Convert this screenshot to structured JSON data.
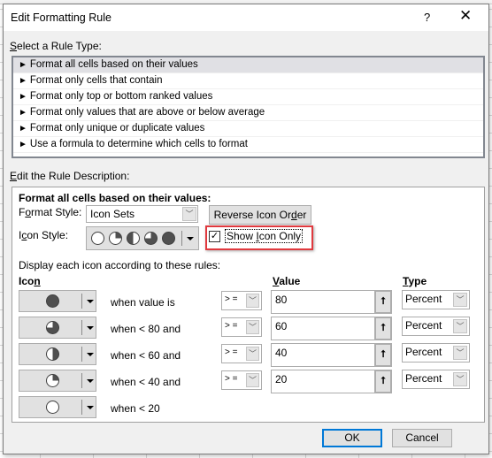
{
  "dialog": {
    "title": "Edit Formatting Rule",
    "help_label": "?",
    "close_label": "✕"
  },
  "rule_type": {
    "label_accel": "S",
    "label_rest": "elect a Rule Type:",
    "arrow_glyph": "►",
    "items": [
      {
        "label": "Format all cells based on their values",
        "selected": true
      },
      {
        "label": "Format only cells that contain",
        "selected": false
      },
      {
        "label": "Format only top or bottom ranked values",
        "selected": false
      },
      {
        "label": "Format only values that are above or below average",
        "selected": false
      },
      {
        "label": "Format only unique or duplicate values",
        "selected": false
      },
      {
        "label": "Use a formula to determine which cells to format",
        "selected": false
      }
    ]
  },
  "rule_description": {
    "label_accel": "E",
    "label_rest": "dit the Rule Description:",
    "heading": "Format all cells based on their values:",
    "format_style_pre": "F",
    "format_style_accel": "o",
    "format_style_post": "rmat Style:",
    "format_style_value": "Icon Sets",
    "reverse_pre": "Reverse Icon Or",
    "reverse_accel": "d",
    "reverse_post": "er",
    "icon_style_pre": "I",
    "icon_style_accel": "c",
    "icon_style_post": "on Style:",
    "icon_style_value": [
      "empty-circle",
      "quarter-circle",
      "half-circle",
      "three-quarter-circle",
      "full-circle"
    ],
    "show_icon_only_pre": "Show ",
    "show_icon_only_accel": "I",
    "show_icon_only_post": "con Only",
    "show_icon_only_checked": true,
    "checkmark": "✓",
    "display_rules_label": "Display each icon according to these rules:",
    "col_icon_pre": "Ico",
    "col_icon_accel": "n",
    "col_value_accel": "V",
    "col_value_post": "alue",
    "col_type_accel": "T",
    "col_type_post": "ype",
    "ref_glyph": "⭡",
    "dd_glyph": "﹀",
    "rules": [
      {
        "icon": "full-circle",
        "condition": "when value is",
        "operator": "> =",
        "value": "80",
        "type": "Percent"
      },
      {
        "icon": "three-quarter-circle",
        "condition": "when < 80 and",
        "operator": "> =",
        "value": "60",
        "type": "Percent"
      },
      {
        "icon": "half-circle",
        "condition": "when < 60 and",
        "operator": "> =",
        "value": "40",
        "type": "Percent"
      },
      {
        "icon": "quarter-circle",
        "condition": "when < 40 and",
        "operator": "> =",
        "value": "20",
        "type": "Percent"
      },
      {
        "icon": "empty-circle",
        "condition": "when < 20"
      }
    ]
  },
  "buttons": {
    "ok": "OK",
    "cancel": "Cancel"
  },
  "colors": {
    "highlight": "#e0393e",
    "focus": "#0078d7"
  }
}
